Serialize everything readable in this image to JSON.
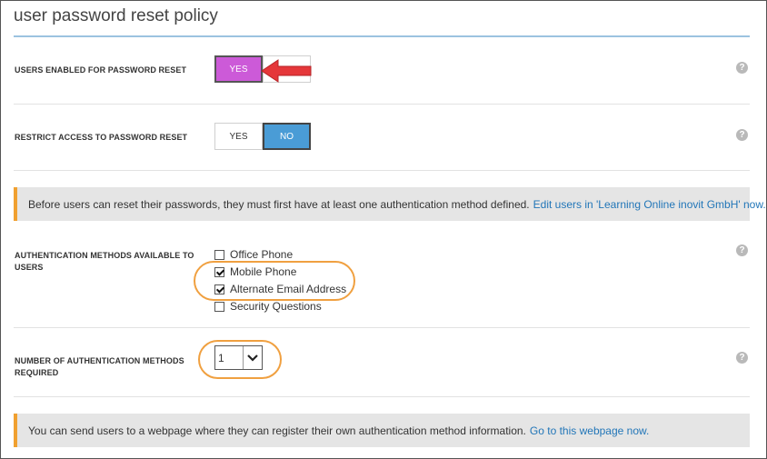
{
  "title": "user password reset policy",
  "enabled_row": {
    "label": "USERS ENABLED FOR PASSWORD RESET",
    "yes": "YES",
    "no": "NO",
    "selected": "YES"
  },
  "restrict_row": {
    "label": "RESTRICT ACCESS TO PASSWORD RESET",
    "yes": "YES",
    "no": "NO",
    "selected": "NO"
  },
  "banner1": {
    "text": "Before users can reset their passwords, they must first have at least one authentication method defined.",
    "link": "Edit users in 'Learning Online inovit GmbH' now."
  },
  "auth_methods": {
    "label": "AUTHENTICATION METHODS AVAILABLE TO USERS",
    "options": [
      {
        "label": "Office Phone",
        "checked": false
      },
      {
        "label": "Mobile Phone",
        "checked": true
      },
      {
        "label": "Alternate Email Address",
        "checked": true
      },
      {
        "label": "Security Questions",
        "checked": false
      }
    ]
  },
  "num_methods": {
    "label": "NUMBER OF AUTHENTICATION METHODS REQUIRED",
    "value": "1"
  },
  "banner2": {
    "text": "You can send users to a webpage where they can register their own authentication method information.",
    "link": "Go to this webpage now."
  },
  "help_glyph": "?",
  "colors": {
    "yes_selected": "#cc5ad8",
    "no_selected": "#4a9cd6",
    "link": "#2276b8",
    "highlight_oval": "#f0a040",
    "annotation_arrow": "#e5373a",
    "banner_accent": "#f0a030"
  }
}
